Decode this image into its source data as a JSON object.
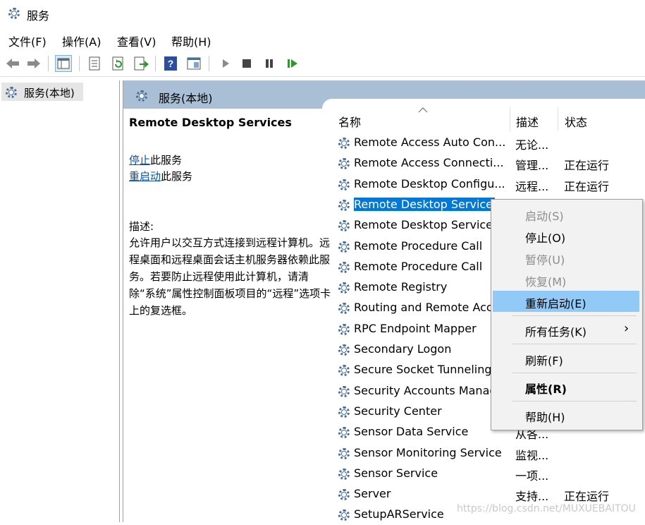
{
  "window": {
    "title": "服务"
  },
  "menu": [
    "文件(F)",
    "操作(A)",
    "查看(V)",
    "帮助(H)"
  ],
  "toolbar": {
    "buttons": [
      "back-icon",
      "forward-icon",
      "show-hide-tree-icon",
      "properties-icon",
      "refresh-icon",
      "export-icon",
      "help-icon",
      "console-icon",
      "start-icon",
      "stop-icon",
      "pause-icon",
      "restart-icon"
    ]
  },
  "tree": {
    "label": "服务(本地)"
  },
  "pane": {
    "title": "服务(本地)",
    "service_name": "Remote Desktop Services",
    "action1_link": "停止",
    "action1_suffix": "此服务",
    "action2_link": "重启动",
    "action2_suffix": "此服务",
    "desc_label": "描述:",
    "desc_text": "允许用户以交互方式连接到远程计算机。远程桌面和远程桌面会话主机服务器依赖此服务。若要防止远程使用此计算机，请清除“系统”属性控制面板项目的“远程”选项卡上的复选框。"
  },
  "table": {
    "headers": {
      "name": "名称",
      "desc": "描述",
      "status": "状态"
    },
    "rows": [
      {
        "name": "Remote Access Auto Con...",
        "desc": "无论...",
        "status": ""
      },
      {
        "name": "Remote Access Connecti...",
        "desc": "管理...",
        "status": "正在运行"
      },
      {
        "name": "Remote Desktop Configu...",
        "desc": "远程...",
        "status": "正在运行"
      },
      {
        "name": "Remote Desktop Services",
        "desc": "",
        "status": ""
      },
      {
        "name": "Remote Desktop Services",
        "desc": "",
        "status": ""
      },
      {
        "name": "Remote Procedure Call",
        "desc": "",
        "status": ""
      },
      {
        "name": "Remote Procedure Call",
        "desc": "",
        "status": ""
      },
      {
        "name": "Remote Registry",
        "desc": "",
        "status": ""
      },
      {
        "name": "Routing and Remote Access",
        "desc": "",
        "status": ""
      },
      {
        "name": "RPC Endpoint Mapper",
        "desc": "",
        "status": ""
      },
      {
        "name": "Secondary Logon",
        "desc": "",
        "status": ""
      },
      {
        "name": "Secure Socket Tunneling",
        "desc": "",
        "status": ""
      },
      {
        "name": "Security Accounts Manager",
        "desc": "",
        "status": ""
      },
      {
        "name": "Security Center",
        "desc": "",
        "status": ""
      },
      {
        "name": "Sensor Data Service",
        "desc": "从各...",
        "status": ""
      },
      {
        "name": "Sensor Monitoring Service",
        "desc": "监视...",
        "status": ""
      },
      {
        "name": "Sensor Service",
        "desc": "一项...",
        "status": ""
      },
      {
        "name": "Server",
        "desc": "支持...",
        "status": "正在运行"
      },
      {
        "name": "SetupARService",
        "desc": "",
        "status": ""
      }
    ]
  },
  "context_menu": {
    "items": [
      "启动(S)",
      "停止(O)",
      "暂停(U)",
      "恢复(M)",
      "重新启动(E)",
      "所有任务(K)",
      "刷新(F)",
      "属性(R)",
      "帮助(H)"
    ],
    "submenu_arrow": "›"
  },
  "watermark": "https://blog.csdn.net/MUXUEBAITOU"
}
